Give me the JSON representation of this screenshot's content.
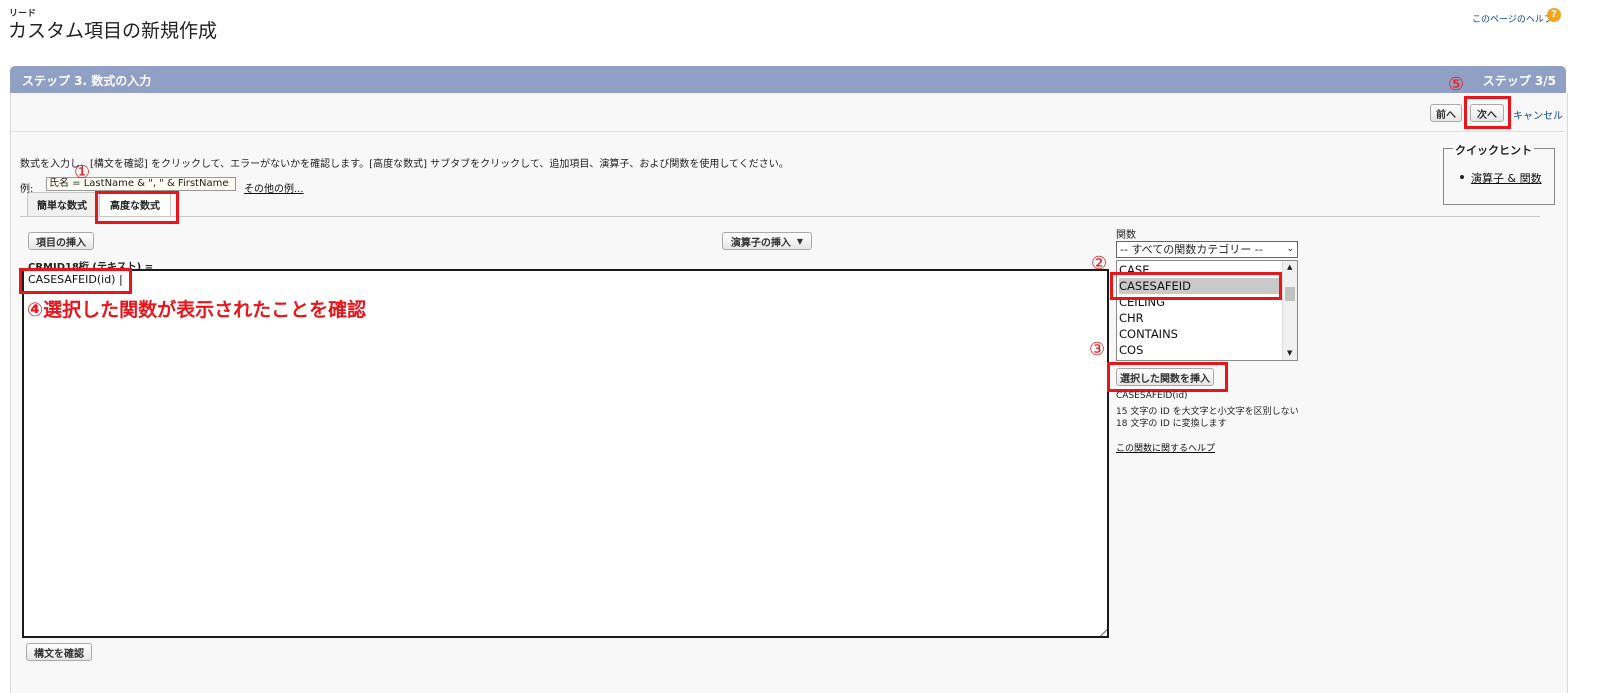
{
  "header": {
    "breadcrumb": "リード",
    "title": "カスタム項目の新規作成",
    "help_link": "このページのヘルプ",
    "help_icon": "?"
  },
  "step_bar": {
    "title": "ステップ 3. 数式の入力",
    "step_count": "ステップ 3/5"
  },
  "toolbar": {
    "prev_label": "前へ",
    "next_label": "次へ",
    "cancel_label": "キャンセル"
  },
  "instructions": {
    "text": "数式を入力し、[構文を確認] をクリックして、エラーがないかを確認します。[高度な数式] サブタブをクリックして、追加項目、演算子、および関数を使用してください。",
    "example_label": "例:",
    "example_value": "氏名 = LastName & \", \" & FirstName",
    "more_examples": "その他の例..."
  },
  "quick_tips": {
    "title": "クイックヒント",
    "link": "演算子 & 関数"
  },
  "tabs": [
    {
      "label": "簡単な数式"
    },
    {
      "label": "高度な数式"
    }
  ],
  "editor": {
    "insert_field": "項目の挿入",
    "insert_operator": "演算子の挿入",
    "field_label": "CRMID18桁 (テキスト) =",
    "formula_value": "CASESAFEID(id) |",
    "check_syntax": "構文を確認"
  },
  "functions": {
    "label": "関数",
    "category_selected": "-- すべての関数カテゴリー --",
    "items": [
      "CASE",
      "CASESAFEID",
      "CEILING",
      "CHR",
      "CONTAINS",
      "COS"
    ],
    "selected": "CASESAFEID",
    "insert_button": "選択した関数を挿入",
    "signature": "CASESAFEID(id)",
    "description": "15 文字の ID を大文字と小文字を区別しない 18 文字の ID に変換します",
    "help_link": "この関数に関するヘルプ"
  },
  "annotations": {
    "n1": "①",
    "n2": "②",
    "n3": "③",
    "n4": "④選択した関数が表示されたことを確認",
    "n5": "⑤"
  },
  "colors": {
    "accent_red": "#e8151b",
    "step_bar": "#8fa0c4",
    "link": "#0a4a96"
  }
}
